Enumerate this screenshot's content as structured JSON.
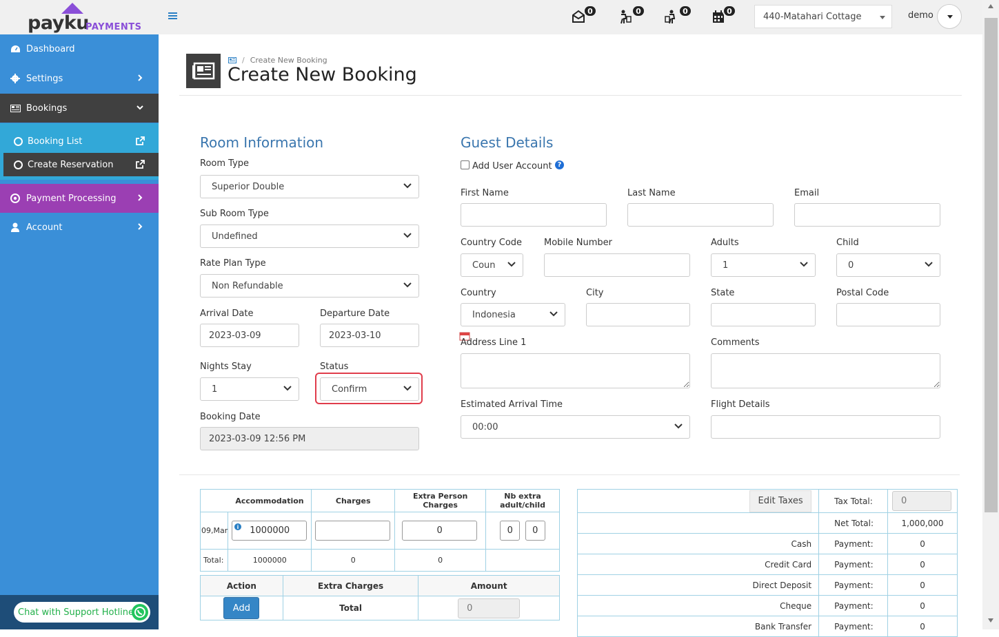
{
  "brand": {
    "name": "payku",
    "sub": "PAYMENTS"
  },
  "sidebar": {
    "items": [
      {
        "label": "Dashboard"
      },
      {
        "label": "Settings"
      },
      {
        "label": "Bookings"
      },
      {
        "label": "Payment Processing"
      },
      {
        "label": "Account"
      }
    ],
    "sub_items": [
      {
        "label": "Booking List"
      },
      {
        "label": "Create Reservation"
      }
    ],
    "chat": "Chat with Support Hotline"
  },
  "topbar": {
    "badges": [
      "0",
      "0",
      "0",
      "0"
    ],
    "hotel": "440-Matahari Cottage",
    "user": "demo"
  },
  "header": {
    "breadcrumb": "Create New Booking",
    "title": "Create New Booking"
  },
  "room": {
    "title": "Room Information",
    "room_type_label": "Room Type",
    "room_type": "Superior Double",
    "sub_room_label": "Sub Room Type",
    "sub_room": "Undefined",
    "rate_plan_label": "Rate Plan Type",
    "rate_plan": "Non Refundable",
    "arrival_label": "Arrival Date",
    "arrival": "2023-03-09",
    "departure_label": "Departure Date",
    "departure": "2023-03-10",
    "nights_label": "Nights Stay",
    "nights": "1",
    "status_label": "Status",
    "status": "Confirm",
    "booking_date_label": "Booking Date",
    "booking_date": "2023-03-09 12:56 PM"
  },
  "guest": {
    "title": "Guest Details",
    "add_user": "Add User Account",
    "first_name": "First Name",
    "last_name": "Last Name",
    "email": "Email",
    "country_code": "Country Code",
    "country_code_val": "Coun",
    "mobile": "Mobile Number",
    "adults": "Adults",
    "adults_val": "1",
    "child": "Child",
    "child_val": "0",
    "country": "Country",
    "country_val": "Indonesia",
    "city": "City",
    "state": "State",
    "postal": "Postal Code",
    "address": "Address Line 1",
    "comments": "Comments",
    "eta": "Estimated Arrival Time",
    "eta_val": "00:00",
    "flight": "Flight Details"
  },
  "accommodation": {
    "headers": [
      "Accommodation",
      "Charges",
      "Extra Person Charges",
      "Nb extra adult/child"
    ],
    "date": "09,Mar",
    "amount": "1000000",
    "extra_person": "0",
    "nb_adult": "0",
    "nb_child": "0",
    "total_label": "Total:",
    "totals": [
      "1000000",
      "0",
      "0"
    ]
  },
  "actions": {
    "headers": [
      "Action",
      "Extra Charges",
      "Amount"
    ],
    "add": "Add",
    "total": "Total",
    "amount": "0"
  },
  "totals": {
    "edit_taxes": "Edit Taxes",
    "tax_total_label": "Tax Total:",
    "tax_total": "0",
    "net_total_label": "Net Total:",
    "net_total": "1,000,000",
    "payments": [
      {
        "method": "Cash",
        "label": "Payment:",
        "value": "0"
      },
      {
        "method": "Credit Card",
        "label": "Payment:",
        "value": "0"
      },
      {
        "method": "Direct Deposit",
        "label": "Payment:",
        "value": "0"
      },
      {
        "method": "Cheque",
        "label": "Payment:",
        "value": "0"
      },
      {
        "method": "Bank Transfer",
        "label": "Payment:",
        "value": "0"
      }
    ]
  }
}
